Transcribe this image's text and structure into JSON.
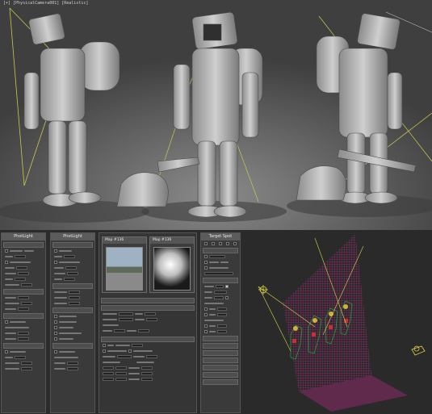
{
  "viewport": {
    "label": "[+] [PhysicalCamera001] [Realistic]"
  },
  "panels": [
    {
      "title": "PhotLight"
    },
    {
      "title": "PhotLight"
    },
    {
      "title": "Target Spot"
    }
  ],
  "map_windows": [
    {
      "title": "Map #136"
    },
    {
      "title": "Map #136"
    }
  ],
  "colors": {
    "viewport_bg": "#5a5a5a",
    "panel_bg": "#3a3a3a",
    "rollout": "#4e4e4e",
    "grid_magenta": "#c8238c",
    "wire_green": "#1f9d3a",
    "light_yellow": "#d6d64a"
  },
  "icons": [
    "light-cone-icon",
    "light-gizmo-icon",
    "bag-icon",
    "axe-icon"
  ]
}
